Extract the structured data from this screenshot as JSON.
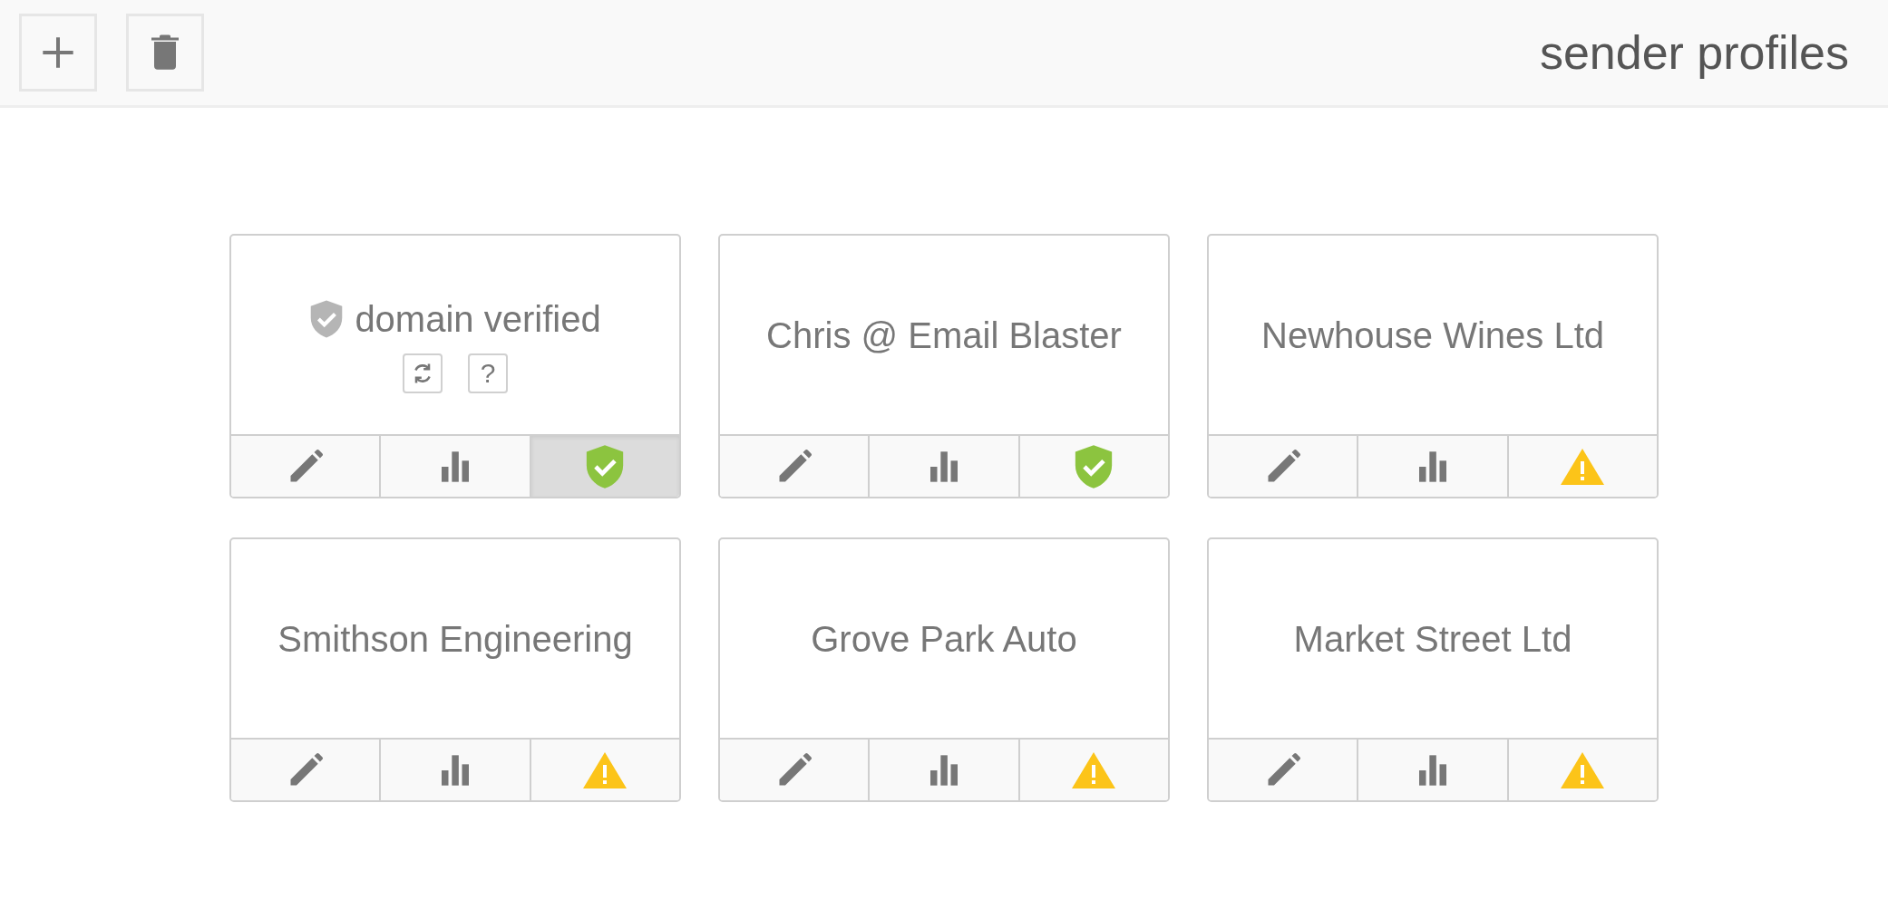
{
  "header": {
    "title": "sender profiles"
  },
  "profiles": [
    {
      "detail": {
        "label": "domain verified",
        "help": "?"
      },
      "kind": "verified",
      "status_open": true
    },
    {
      "name": "Chris @ Email Blaster",
      "kind": "verified",
      "status_open": false
    },
    {
      "name": "Newhouse Wines Ltd",
      "kind": "warning",
      "status_open": false
    },
    {
      "name": "Smithson Engineering",
      "kind": "warning",
      "status_open": false
    },
    {
      "name": "Grove Park Auto",
      "kind": "warning",
      "status_open": false
    },
    {
      "name": "Market Street Ltd",
      "kind": "warning",
      "status_open": false
    }
  ]
}
